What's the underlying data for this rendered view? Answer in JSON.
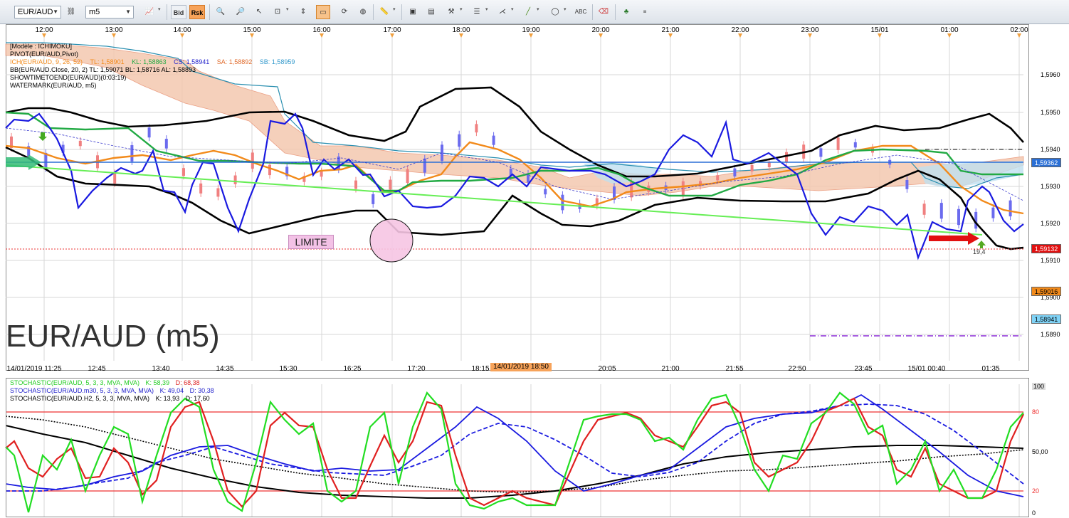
{
  "toolbar": {
    "symbol": "EUR/AUD",
    "timeframe": "m5",
    "bid_label": "Bid",
    "ask_label": "Rsk"
  },
  "chart": {
    "watermark": "EUR/AUD (m5)",
    "annotation": "LIMITE",
    "top_times": [
      "12:00",
      "13:00",
      "14:00",
      "15:00",
      "16:00",
      "17:00",
      "18:00",
      "19:00",
      "20:00",
      "21:00",
      "22:00",
      "23:00",
      "15/01",
      "01:00",
      "02:00"
    ],
    "bottom_times": [
      "14/01/2019 11:25",
      "12:45",
      "13:40",
      "14:35",
      "15:30",
      "16:25",
      "17:20",
      "18:15",
      "20:05",
      "21:00",
      "21:55",
      "22:50",
      "23:45",
      "15/01 00:40",
      "01:35"
    ],
    "cursor_time": "14/01/2019 18:50",
    "price_ticks": [
      "1,5960",
      "1,5950",
      "1,5940",
      "1,5930",
      "1,5920",
      "1,5910",
      "1,5900",
      "1,5890"
    ],
    "price_tags": {
      "current": "1,59362",
      "limit": "1,59132",
      "orange": "1,59016",
      "blue": "1,58941"
    },
    "arrow_label": "19,4",
    "indicators": [
      {
        "text": "[Modèle : ICHIMOKU]",
        "color": "#6a6a8a"
      },
      {
        "text": "PIVOT(EUR/AUD,Pivot)",
        "color": "#000000"
      },
      {
        "text": "ICH(EUR/AUD, 9, 26, 52)",
        "color": "#f28a1a"
      },
      {
        "text": "BB(EUR/AUD.Close, 20, 2)  TL: 1,59071  BL: 1,58716  AL: 1,58893",
        "color": "#000000"
      },
      {
        "text": "SHOWTIMETOEND(EUR/AUD)(0:03:19)",
        "color": "#000000"
      },
      {
        "text": "WATERMARK(EUR/AUD, m5)",
        "color": "#000000"
      }
    ],
    "ich_values": [
      {
        "text": "TL: 1,58901",
        "color": "#f28a1a"
      },
      {
        "text": "KL: 1,58863",
        "color": "#22aa44"
      },
      {
        "text": "CS: 1,58941",
        "color": "#2222cc"
      },
      {
        "text": "SA: 1,58892",
        "color": "#e06a2a"
      },
      {
        "text": "SB: 1,58959",
        "color": "#3399cc"
      }
    ]
  },
  "stoch": {
    "lines": [
      {
        "label": "STOCHASTIC(EUR/AUD, 5, 3, 3, MVA, MVA)",
        "k": "K: 58,39",
        "d": "D: 68,38",
        "color": "#22cc22",
        "dcolor": "#dd2222"
      },
      {
        "label": "STOCHASTIC(EUR/AUD.m30, 5, 3, 3, MVA, MVA)",
        "k": "K: 49,04",
        "d": "D: 30,38",
        "color": "#2222cc",
        "dcolor": "#2222cc"
      },
      {
        "label": "STOCHASTIC(EUR/AUD.H2, 5, 3, 3, MVA, MVA)",
        "k": "K: 13,93",
        "d": "D: 17,60",
        "color": "#000000",
        "dcolor": "#000000"
      }
    ],
    "levels": [
      "100",
      "80",
      "50,00",
      "20",
      "0"
    ]
  }
}
